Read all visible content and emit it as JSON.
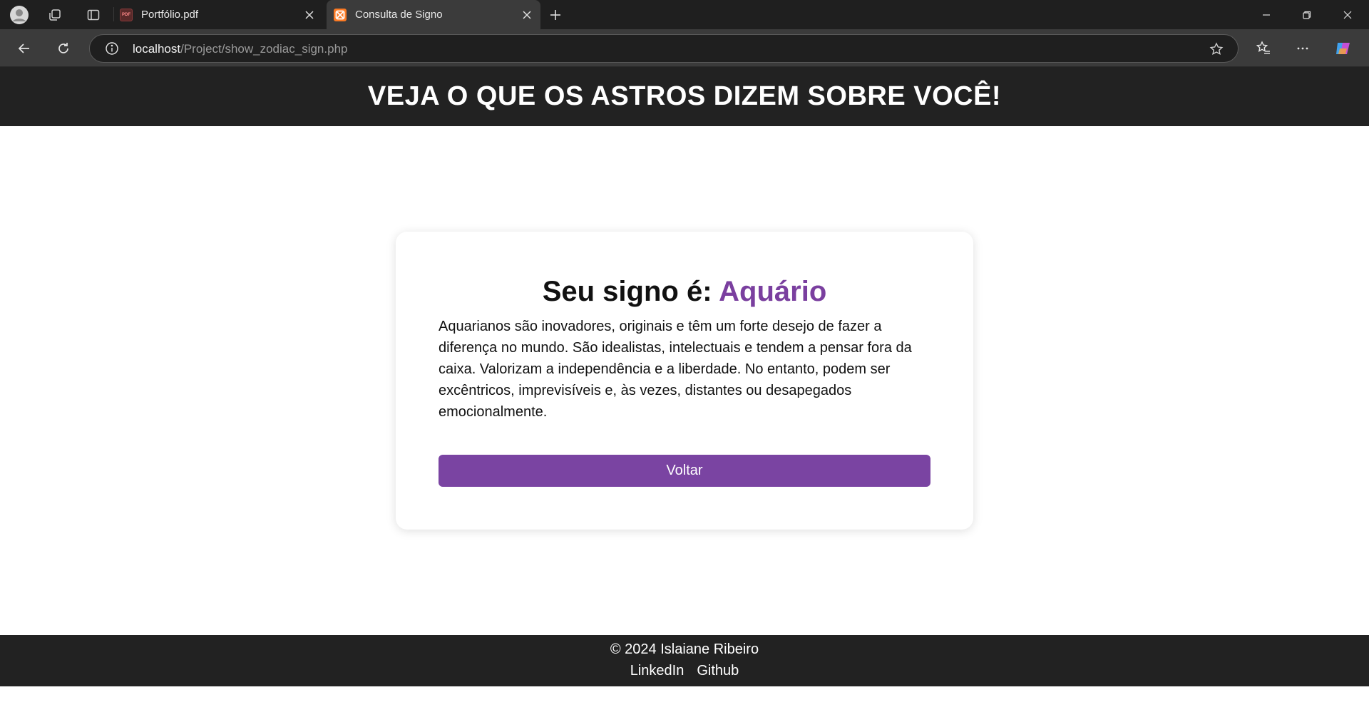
{
  "browser": {
    "tabs": [
      {
        "title": "Portfólio.pdf",
        "favicon": "pdf-icon",
        "active": false
      },
      {
        "title": "Consulta de Signo",
        "favicon": "xampp-icon",
        "active": true
      }
    ],
    "url_host": "localhost",
    "url_path": "/Project/show_zodiac_sign.php"
  },
  "header": {
    "title": "VEJA O QUE OS ASTROS DIZEM SOBRE VOCÊ!"
  },
  "card": {
    "title_prefix": "Seu signo é: ",
    "sign": "Aquário",
    "description": "Aquarianos são inovadores, originais e têm um forte desejo de fazer a diferença no mundo. São idealistas, intelectuais e tendem a pensar fora da caixa. Valorizam a independência e a liberdade. No entanto, podem ser excêntricos, imprevisíveis e, às vezes, distantes ou desapegados emocionalmente.",
    "button_label": "Voltar"
  },
  "footer": {
    "copyright": "© 2024 Islaiane Ribeiro",
    "links": [
      "LinkedIn",
      "Github"
    ]
  },
  "colors": {
    "accent": "#7a44a2",
    "header_bg": "#222222"
  }
}
